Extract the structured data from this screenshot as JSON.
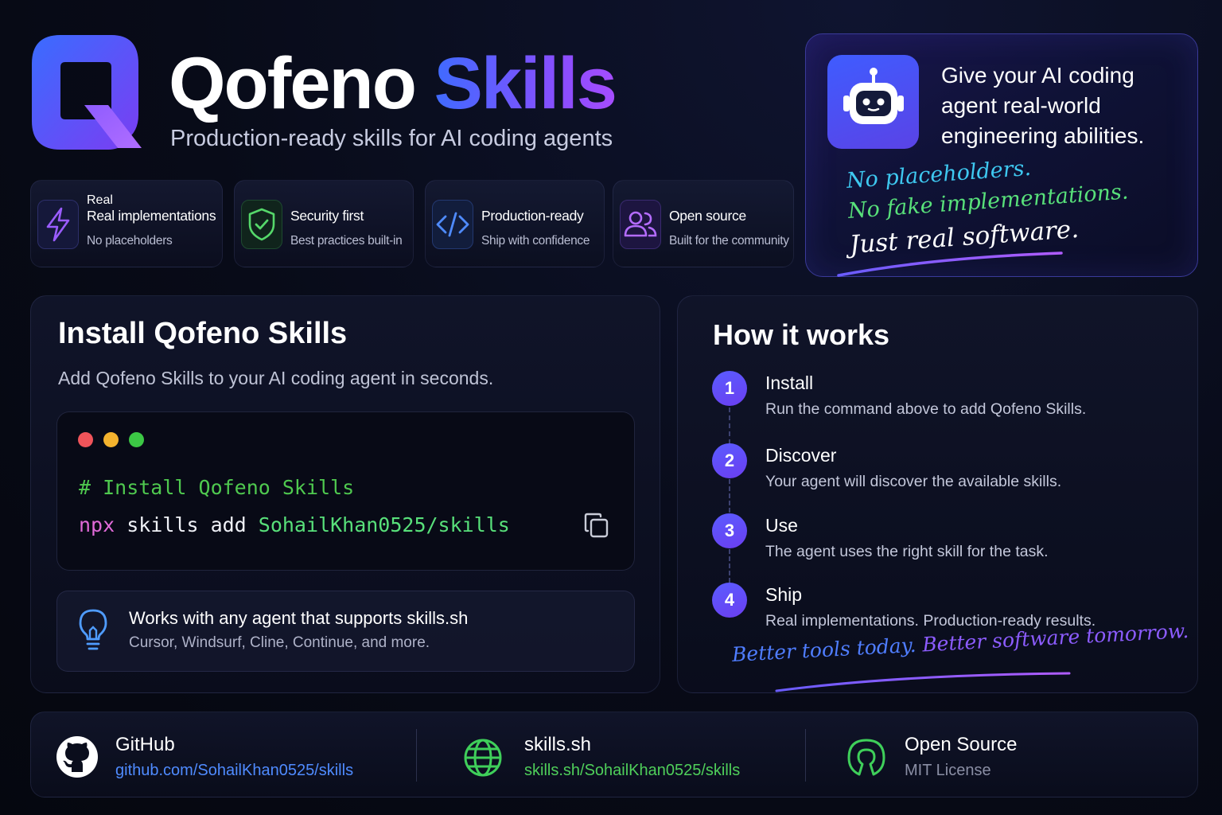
{
  "header": {
    "title_part1": "Qofeno",
    "title_part2": "Skills",
    "tagline": "Production-ready skills for AI coding agents"
  },
  "features": [
    {
      "pre": "Real",
      "title": "Real implementations",
      "subtitle": "No placeholders",
      "icon": "lightning-icon"
    },
    {
      "title": "Security first",
      "subtitle": "Best practices built-in",
      "icon": "shield-check-icon"
    },
    {
      "title": "Production-ready",
      "subtitle": "Ship with confidence",
      "icon": "code-icon"
    },
    {
      "title": "Open source",
      "subtitle": "Built for the community",
      "icon": "users-icon"
    }
  ],
  "hero": {
    "text": "Give your AI coding agent real-world engineering abilities.",
    "hand_line1": "No placeholders.",
    "hand_line2": "No fake implementations.",
    "hand_line3": "Just real software.",
    "icon": "robot-icon"
  },
  "install": {
    "title": "Install Qofeno Skills",
    "subtitle": "Add Qofeno Skills to your AI coding agent in seconds.",
    "comment": "# Install Qofeno Skills",
    "cmd_npx": "npx",
    "cmd_mid": " skills add ",
    "cmd_repo": "SohailKhan0525/skills",
    "works_title": "Works with any agent that supports skills.sh",
    "works_sub": "Cursor, Windsurf, Cline, Continue, and more."
  },
  "how": {
    "title": "How it works",
    "steps": [
      {
        "num": "1",
        "title": "Install",
        "desc": "Run the command above to add Qofeno Skills."
      },
      {
        "num": "2",
        "title": "Discover",
        "desc": "Your agent will discover the available skills."
      },
      {
        "num": "3",
        "title": "Use",
        "desc": "The agent uses the right skill for the task."
      },
      {
        "num": "4",
        "title": "Ship",
        "desc": "Real implementations. Production-ready results."
      }
    ],
    "hand_part1": "Better tools today.",
    "hand_part2": " Better software tomorrow."
  },
  "footer": {
    "github_label": "GitHub",
    "github_link": "github.com/SohailKhan0525/skills",
    "site_label": "skills.sh",
    "site_link": "skills.sh/SohailKhan0525/skills",
    "license_label": "Open Source",
    "license_value": "MIT License"
  },
  "colors": {
    "accent_blue": "#3f6bff",
    "accent_purple": "#8a4dff",
    "green": "#58e07a",
    "link_blue": "#4f8bff"
  }
}
